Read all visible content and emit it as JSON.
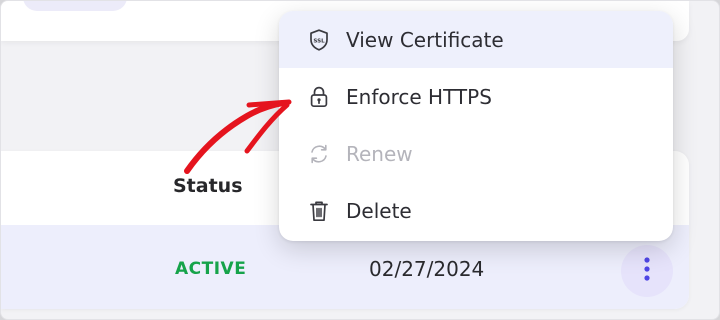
{
  "table": {
    "status_header": "Status",
    "row": {
      "status": "ACTIVE",
      "date": "02/27/2024"
    }
  },
  "menu": {
    "items": [
      {
        "label": "View Certificate",
        "icon": "ssl-shield-icon",
        "disabled": false
      },
      {
        "label": "Enforce HTTPS",
        "icon": "lock-icon",
        "disabled": false
      },
      {
        "label": "Renew",
        "icon": "refresh-icon",
        "disabled": true
      },
      {
        "label": "Delete",
        "icon": "trash-icon",
        "disabled": false
      }
    ]
  },
  "colors": {
    "accent": "#4f46e5",
    "active_status": "#16a34a",
    "annotation_arrow": "#e5141e",
    "menu_highlight": "#eef0fc",
    "row_background": "#edeefc"
  }
}
